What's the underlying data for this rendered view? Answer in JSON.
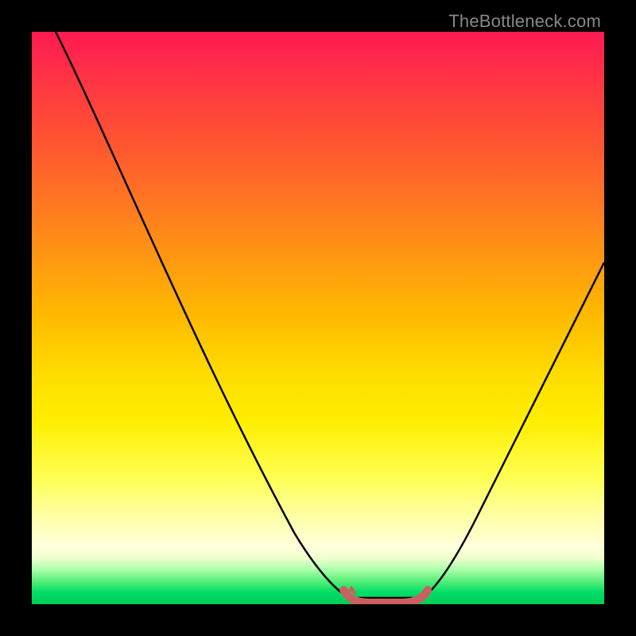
{
  "watermark": "TheBottleneck.com",
  "chart_data": {
    "type": "line",
    "title": "",
    "xlabel": "",
    "ylabel": "",
    "xlim": [
      0,
      100
    ],
    "ylim": [
      0,
      100
    ],
    "series": [
      {
        "name": "bottleneck-curve",
        "x": [
          0,
          10,
          20,
          30,
          40,
          50,
          55,
          58,
          60,
          65,
          68,
          70,
          75,
          80,
          90,
          100
        ],
        "y": [
          100,
          82,
          63,
          45,
          27,
          10,
          3,
          0,
          0,
          0,
          0,
          3,
          13,
          25,
          48,
          68
        ]
      },
      {
        "name": "optimal-band",
        "x": [
          55,
          58,
          60,
          63,
          66,
          68
        ],
        "y": [
          2,
          1,
          1,
          1,
          1,
          2
        ]
      }
    ],
    "colors": {
      "curve": "#000000",
      "band": "#d66666",
      "gradient_top": "#ff1a52",
      "gradient_bottom": "#00cc55"
    }
  }
}
